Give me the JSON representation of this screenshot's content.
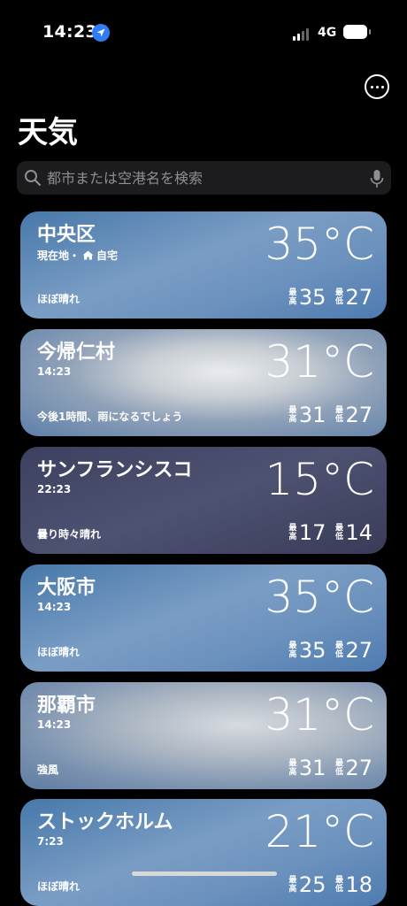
{
  "status_bar": {
    "time": "14:23",
    "network": "4G"
  },
  "header": {
    "title": "天気"
  },
  "search": {
    "placeholder": "都市または空港名を検索"
  },
  "labels": {
    "high": "最高",
    "low": "最低"
  },
  "cities": [
    {
      "name": "中央区",
      "subtitle": "現在地・",
      "home_label": "自宅",
      "condition": "ほぼ晴れ",
      "temp": "35°C",
      "high": "35",
      "low": "27"
    },
    {
      "name": "今帰仁村",
      "subtitle": "14:23",
      "condition": "今後1時間、雨になるでしょう",
      "temp": "31°C",
      "high": "31",
      "low": "27"
    },
    {
      "name": "サンフランシスコ",
      "subtitle": "22:23",
      "condition": "曇り時々晴れ",
      "temp": "15°C",
      "high": "17",
      "low": "14"
    },
    {
      "name": "大阪市",
      "subtitle": "14:23",
      "condition": "ほぼ晴れ",
      "temp": "35°C",
      "high": "35",
      "low": "27"
    },
    {
      "name": "那覇市",
      "subtitle": "14:23",
      "condition": "強風",
      "temp": "31°C",
      "high": "31",
      "low": "27"
    },
    {
      "name": "ストックホルム",
      "subtitle": "7:23",
      "condition": "ほぼ晴れ",
      "temp": "21°C",
      "high": "25",
      "low": "18"
    }
  ],
  "colors": {
    "background": "#000000",
    "search_bg": "#1c1c1e",
    "location_arrow": "#2f7cf6"
  },
  "icons": [
    "location-arrow-icon",
    "signal-icon",
    "battery-icon",
    "more-icon",
    "search-icon",
    "microphone-icon",
    "home-icon"
  ]
}
